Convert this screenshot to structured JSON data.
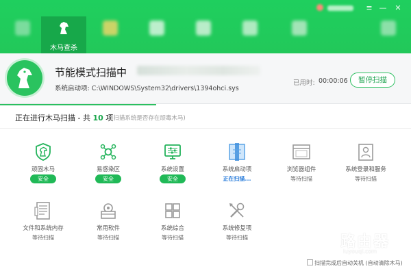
{
  "window": {
    "brand_color": "#22c85a",
    "controls": [
      {
        "name": "menu-icon",
        "glyph": "≡"
      },
      {
        "name": "minimize-icon",
        "glyph": "—"
      },
      {
        "name": "close-icon",
        "glyph": "✕"
      }
    ]
  },
  "tabs": [
    {
      "label": "",
      "icon": "blurred-icon"
    },
    {
      "label": "木马查杀",
      "icon": "horse-icon",
      "active": true
    },
    {
      "label": "",
      "icon": "blurred-icon"
    },
    {
      "label": "",
      "icon": "blurred-icon"
    },
    {
      "label": "",
      "icon": "blurred-icon"
    },
    {
      "label": "",
      "icon": "blurred-icon"
    },
    {
      "label": "",
      "icon": "blurred-icon"
    },
    {
      "label": "",
      "icon": "blurred-icon"
    }
  ],
  "scan": {
    "title": "节能模式扫描中",
    "file_prefix": "系统启动项:",
    "file_path": "C:\\WINDOWS\\System32\\drivers\\1394ohci.sys",
    "time_label": "已用时:",
    "time_value": "00:00:06",
    "pause_label": "暂停扫描"
  },
  "progress": {
    "title_prefix": "正在进行木马扫描 - 共 ",
    "count": "10",
    "title_suffix": " 项",
    "hint": "(扫描系统是否存在顽毒木马)",
    "fraction": 0.38
  },
  "items": [
    {
      "label": "顽固木马",
      "status": "安全",
      "state": "safe",
      "icon": "shield-horse-icon"
    },
    {
      "label": "易感染区",
      "status": "安全",
      "state": "safe",
      "icon": "network-icon"
    },
    {
      "label": "系统设置",
      "status": "安全",
      "state": "safe",
      "icon": "monitor-settings-icon"
    },
    {
      "label": "系统启动项",
      "status": "正在扫描...",
      "state": "scanning",
      "icon": "startup-scan-icon"
    },
    {
      "label": "浏览器组件",
      "status": "等待扫描",
      "state": "waiting",
      "icon": "browser-window-icon"
    },
    {
      "label": "系统登录和服务",
      "status": "等待扫描",
      "state": "waiting",
      "icon": "user-login-icon"
    },
    {
      "label": "文件和系统内存",
      "status": "等待扫描",
      "state": "waiting",
      "icon": "document-memory-icon"
    },
    {
      "label": "常用软件",
      "status": "等待扫描",
      "state": "waiting",
      "icon": "software-box-icon"
    },
    {
      "label": "系统综合",
      "status": "等待扫描",
      "state": "waiting",
      "icon": "windows-logo-icon"
    },
    {
      "label": "系统修复项",
      "status": "等待扫描",
      "state": "waiting",
      "icon": "tools-repair-icon"
    }
  ],
  "footer": {
    "auto_shutdown_label": "扫描完成后自动关机 (自动清除木马)"
  },
  "watermark": {
    "text": "路由器",
    "url": "luyouqi.com"
  },
  "colors": {
    "safe_badge": "#20b957",
    "scanning": "#2a7ddb",
    "waiting_icon": "#9a9a9a",
    "done_icon": "#22b35a"
  }
}
